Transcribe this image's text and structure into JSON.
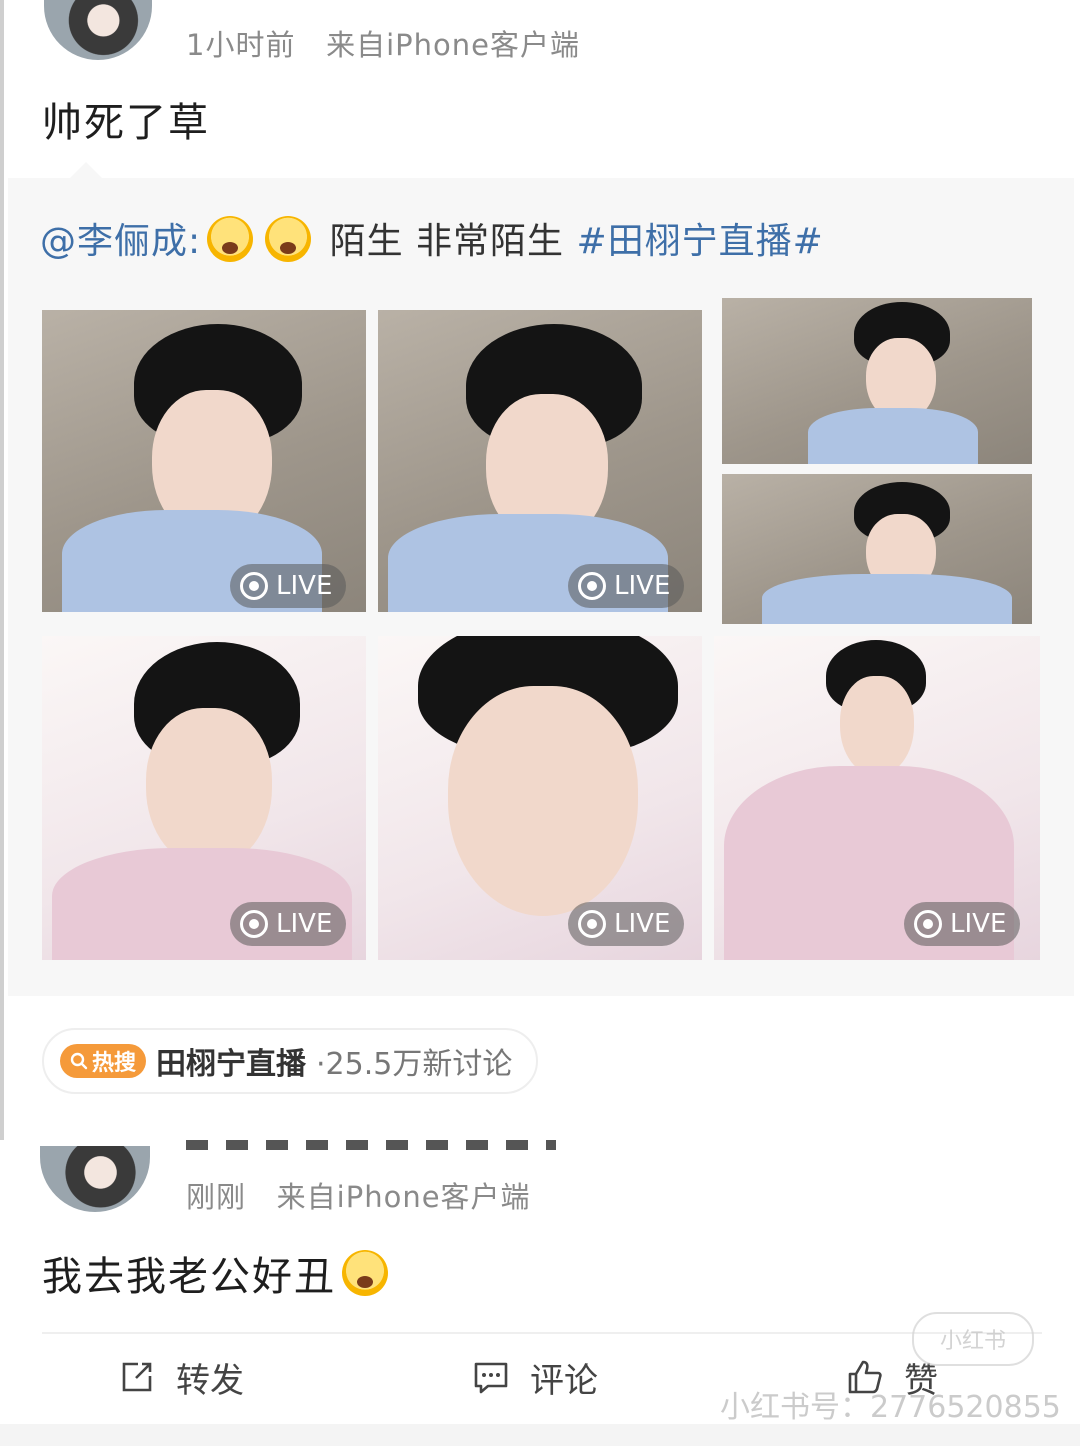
{
  "post1": {
    "time": "1小时前",
    "source": "来自iPhone客户端",
    "text": "帅死了草"
  },
  "quoted": {
    "mention": "@李俪成:",
    "text": "陌生 非常陌生",
    "hashtag": "#田栩宁直播#",
    "live_label": "LIVE"
  },
  "trend": {
    "badge": "热搜",
    "title": "田栩宁直播",
    "count": "·25.5万新讨论"
  },
  "post2": {
    "time": "刚刚",
    "source": "来自iPhone客户端",
    "text": "我去我老公好丑"
  },
  "actions": {
    "repost": "转发",
    "comment": "评论",
    "like": "赞"
  },
  "watermark": {
    "text": "小红书号：2776520855",
    "logo": "小红书"
  },
  "colors": {
    "link": "#3e6fa8",
    "hot": "#f59a3a",
    "meta": "#8a8a8a"
  }
}
